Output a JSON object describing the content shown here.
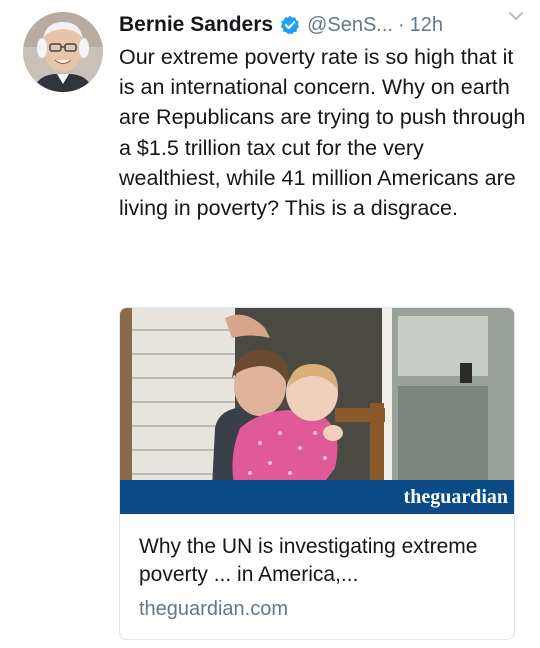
{
  "tweet": {
    "author_name": "Bernie Sanders",
    "handle": "@SenS...",
    "separator": "·",
    "time": "12h",
    "text": "Our extreme poverty rate is so high that it is an international concern. Why on earth are Republicans are trying to push through a $1.5 trillion tax cut for the very wealthiest, while 41 million Americans are living in poverty? This is a disgrace."
  },
  "card": {
    "brand_logo": "theguardian",
    "title": "Why the UN is investigating extreme poverty ... in America,...",
    "domain": "theguardian.com"
  },
  "icons": {
    "verified": "verified-badge-icon",
    "menu": "chevron-down-icon"
  },
  "colors": {
    "verified_blue": "#1da1f2",
    "muted_text": "#657786",
    "guardian_band": "#0a4a86"
  }
}
